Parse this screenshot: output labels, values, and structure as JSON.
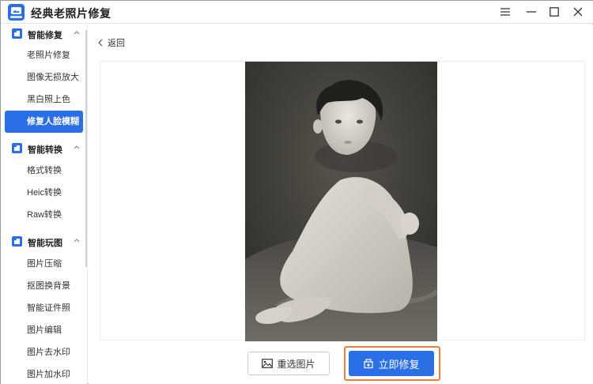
{
  "app": {
    "title": "经典老照片修复"
  },
  "window_controls": {
    "icons": [
      "menu-icon",
      "minimize-icon",
      "maximize-icon",
      "close-icon"
    ]
  },
  "sidebar": {
    "groups": [
      {
        "label": "智能修复",
        "items": [
          "老照片修复",
          "图像无损放大",
          "黑白照上色",
          "修复人脸模糊"
        ]
      },
      {
        "label": "智能转换",
        "items": [
          "格式转换",
          "Heic转换",
          "Raw转换"
        ]
      },
      {
        "label": "智能玩图",
        "items": [
          "图片压缩",
          "抠图换背景",
          "智能证件照",
          "图片编辑",
          "图片去水印",
          "图片加水印"
        ]
      }
    ],
    "active_item": "修复人脸模糊"
  },
  "main": {
    "back_label": "返回",
    "reselect_label": "重选图片",
    "repair_label": "立即修复"
  },
  "colors": {
    "accent": "#2a6fe6",
    "highlight": "#f07a3e"
  }
}
